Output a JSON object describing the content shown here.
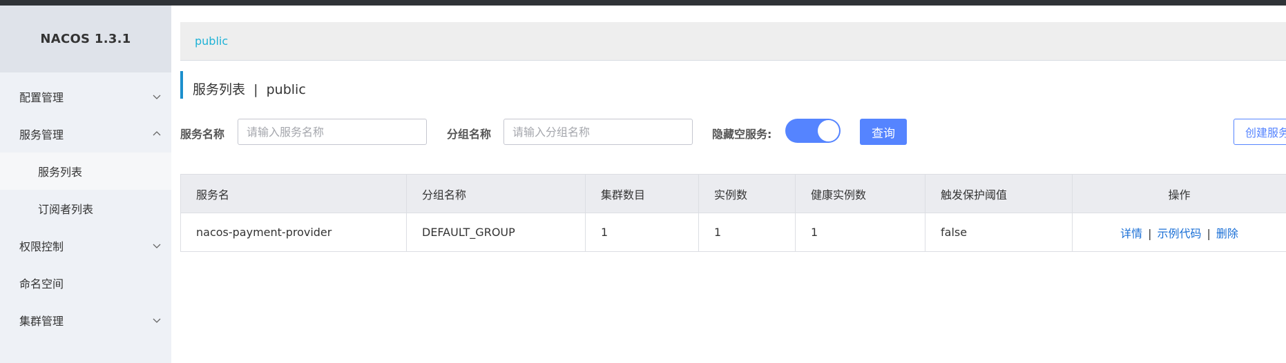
{
  "app": {
    "brand": "NACOS 1.3.1"
  },
  "sidebar": {
    "items": [
      {
        "label": "配置管理",
        "chevron": "down"
      },
      {
        "label": "服务管理",
        "chevron": "up"
      },
      {
        "label": "服务列表",
        "sub": true,
        "active": true
      },
      {
        "label": "订阅者列表",
        "sub": true
      },
      {
        "label": "权限控制",
        "chevron": "down"
      },
      {
        "label": "命名空间"
      },
      {
        "label": "集群管理",
        "chevron": "down"
      }
    ]
  },
  "namespace_bar": {
    "current": "public"
  },
  "page": {
    "title": "服务列表",
    "separator": "|",
    "namespace": "public"
  },
  "filters": {
    "service_name_label": "服务名称",
    "service_name_placeholder": "请输入服务名称",
    "group_name_label": "分组名称",
    "group_name_placeholder": "请输入分组名称",
    "hide_empty_label": "隐藏空服务:",
    "hide_empty_on": true,
    "query_button": "查询",
    "create_button": "创建服务"
  },
  "table": {
    "headers": [
      "服务名",
      "分组名称",
      "集群数目",
      "实例数",
      "健康实例数",
      "触发保护阈值",
      "操作"
    ],
    "rows": [
      {
        "service": "nacos-payment-provider",
        "group": "DEFAULT_GROUP",
        "clusters": "1",
        "instances": "1",
        "healthy": "1",
        "threshold": "false",
        "actions": [
          "详情",
          "示例代码",
          "删除"
        ]
      }
    ]
  },
  "colors": {
    "primary": "#5584ff",
    "link": "#1a6fd6",
    "accent": "#1c8fcd",
    "crumb": "#1fb2d6"
  }
}
